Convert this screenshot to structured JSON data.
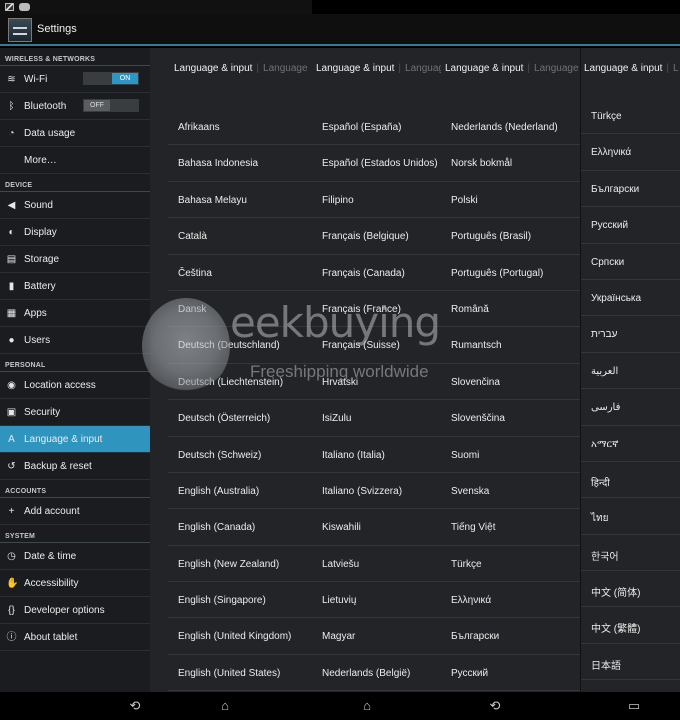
{
  "app": {
    "title": "Settings"
  },
  "sidebar": {
    "sections": [
      {
        "header": "WIRELESS & NETWORKS",
        "items": [
          {
            "label": "Wi-Fi",
            "icon": "wifi-icon",
            "toggle": "ON"
          },
          {
            "label": "Bluetooth",
            "icon": "bluetooth-icon",
            "toggle": "OFF"
          },
          {
            "label": "Data usage",
            "icon": "data-usage-icon"
          },
          {
            "label": "More…",
            "icon": ""
          }
        ]
      },
      {
        "header": "DEVICE",
        "items": [
          {
            "label": "Sound",
            "icon": "speaker-icon"
          },
          {
            "label": "Display",
            "icon": "brightness-icon"
          },
          {
            "label": "Storage",
            "icon": "storage-icon"
          },
          {
            "label": "Battery",
            "icon": "battery-icon"
          },
          {
            "label": "Apps",
            "icon": "apps-icon"
          },
          {
            "label": "Users",
            "icon": "user-icon"
          }
        ]
      },
      {
        "header": "PERSONAL",
        "items": [
          {
            "label": "Location access",
            "icon": "location-icon"
          },
          {
            "label": "Security",
            "icon": "lock-icon"
          },
          {
            "label": "Language & input",
            "icon": "keyboard-letter-icon",
            "selected": true
          },
          {
            "label": "Backup & reset",
            "icon": "backup-icon"
          }
        ]
      },
      {
        "header": "ACCOUNTS",
        "items": [
          {
            "label": "Add account",
            "icon": "plus-icon"
          }
        ]
      },
      {
        "header": "SYSTEM",
        "items": [
          {
            "label": "Date & time",
            "icon": "clock-icon"
          },
          {
            "label": "Accessibility",
            "icon": "hand-icon"
          },
          {
            "label": "Developer options",
            "icon": "braces-icon"
          },
          {
            "label": "About tablet",
            "icon": "info-icon"
          }
        ]
      }
    ]
  },
  "panels": [
    {
      "title": "Language & input",
      "ghost": "Language",
      "items": [
        "Afrikaans",
        "Bahasa Indonesia",
        "Bahasa Melayu",
        "Català",
        "Čeština",
        "Dansk",
        "Deutsch (Deutschland)",
        "Deutsch (Liechtenstein)",
        "Deutsch (Österreich)",
        "Deutsch (Schweiz)",
        "English (Australia)",
        "English (Canada)",
        "English (New Zealand)",
        "English (Singapore)",
        "English (United Kingdom)",
        "English (United States)",
        "Español (España)"
      ]
    },
    {
      "title": "Language & input",
      "ghost": "Languag",
      "items": [
        "Español (España)",
        "Español (Estados Unidos)",
        "Filipino",
        "Français (Belgique)",
        "Français (Canada)",
        "Français (France)",
        "Français (Suisse)",
        "Hrvatski",
        "IsiZulu",
        "Italiano (Italia)",
        "Italiano (Svizzera)",
        "Kiswahili",
        "Latviešu",
        "Lietuvių",
        "Magyar",
        "Nederlands (België)",
        "Nederlands (Nederland)"
      ]
    },
    {
      "title": "Language & input",
      "ghost": "Language",
      "items": [
        "Nederlands (Nederland)",
        "Norsk bokmål",
        "Polski",
        "Português (Brasil)",
        "Português (Portugal)",
        "Română",
        "Rumantsch",
        "Slovenčina",
        "Slovenščina",
        "Suomi",
        "Svenska",
        "Tiếng Việt",
        "Türkçe",
        "Ελληνικά",
        "Български",
        "Русский",
        "Српски"
      ]
    },
    {
      "title": "Language & input",
      "ghost": "L",
      "items": [
        "Türkçe",
        "Ελληνικά",
        "Български",
        "Русский",
        "Српски",
        "Українська",
        "עברית",
        "العربية",
        "فارسی",
        "አማርኛ",
        "हिन्दी",
        "ไทย",
        "한국어",
        "中文 (简体)",
        "中文 (繁體)",
        "日本語"
      ]
    }
  ],
  "watermark": {
    "brand": "eekbuying",
    "tagline": "Freeshipping worldwide"
  },
  "colors": {
    "accent": "#2f94be",
    "actionbar_rule": "#2d7f97",
    "sidebar_bg": "#1a1c1f",
    "content_bg": "#222427"
  }
}
